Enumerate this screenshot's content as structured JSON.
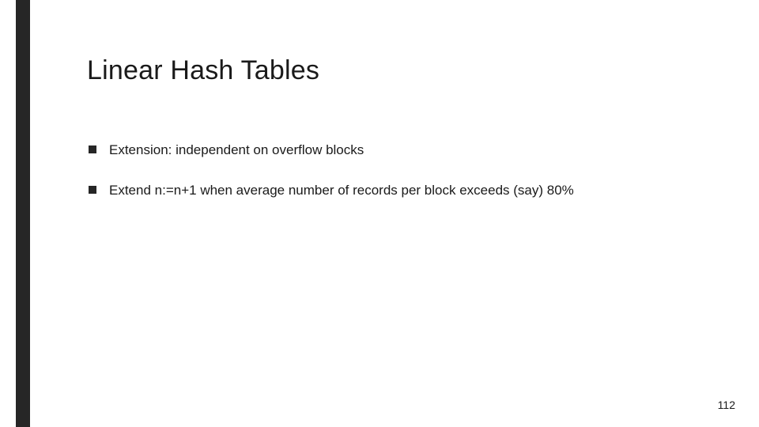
{
  "slide": {
    "title": "Linear Hash Tables",
    "bullets": [
      "Extension: independent on overflow blocks",
      "Extend n:=n+1 when average number of records per block exceeds (say) 80%"
    ],
    "page_number": "112"
  }
}
